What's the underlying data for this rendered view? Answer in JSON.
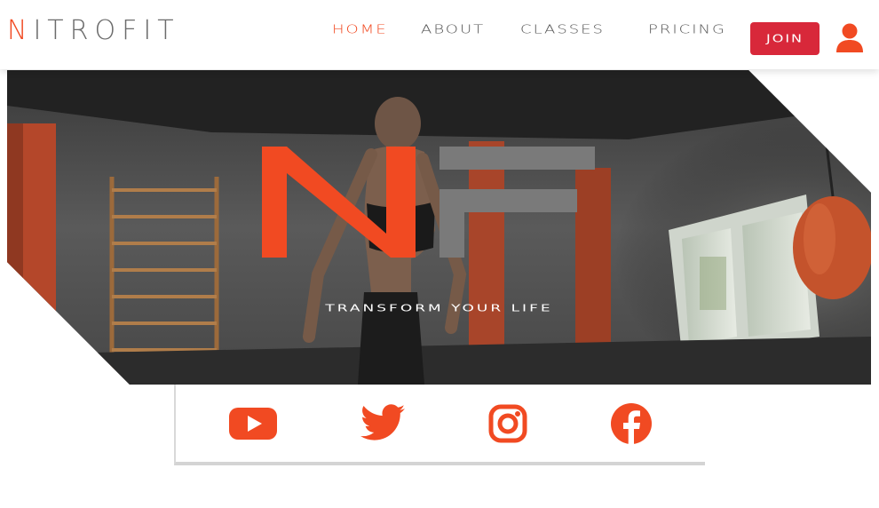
{
  "brand": {
    "logo_initial": "N",
    "logo_rest": "ITROFIT",
    "accent_color": "#f14a22",
    "join_color": "#d8283a",
    "text_gray": "#555555"
  },
  "nav": {
    "items": [
      {
        "label": "HOME",
        "active": true
      },
      {
        "label": "ABOUT",
        "active": false
      },
      {
        "label": "CLASSES",
        "active": false
      },
      {
        "label": "PRICING",
        "active": false
      }
    ],
    "join_label": "JOIN",
    "user_icon": "user-icon"
  },
  "hero": {
    "mark_letters": "NF",
    "tagline": "TRANSFORM YOUR LIFE"
  },
  "social": {
    "links": [
      {
        "name": "youtube",
        "icon": "youtube-icon"
      },
      {
        "name": "twitter",
        "icon": "twitter-icon"
      },
      {
        "name": "instagram",
        "icon": "instagram-icon"
      },
      {
        "name": "facebook",
        "icon": "facebook-icon"
      }
    ]
  }
}
